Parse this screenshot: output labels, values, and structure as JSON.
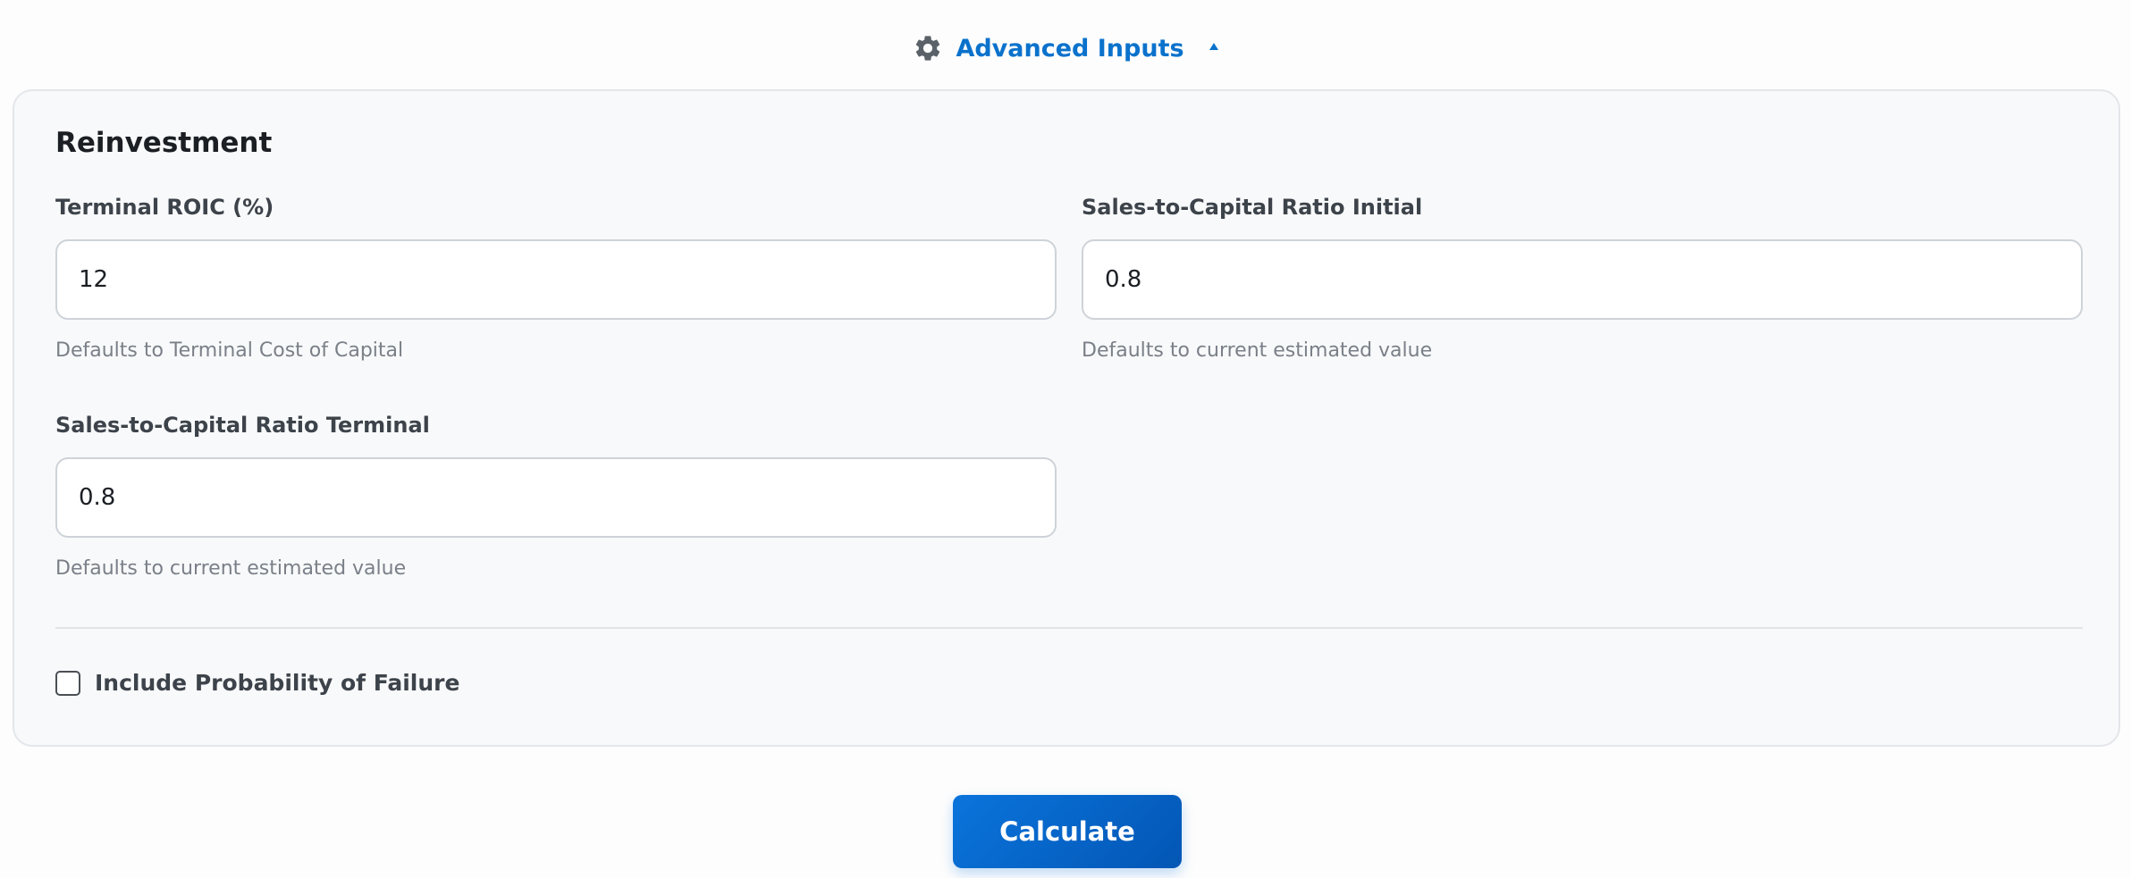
{
  "header": {
    "icon": "gear-icon",
    "title": "Advanced Inputs",
    "caret_icon": "caret-up-icon"
  },
  "section": {
    "title": "Reinvestment",
    "fields": [
      {
        "label": "Terminal ROIC (%)",
        "value": "12",
        "hint": "Defaults to Terminal Cost of Capital"
      },
      {
        "label": "Sales-to-Capital Ratio Initial",
        "value": "0.8",
        "hint": "Defaults to current estimated value"
      },
      {
        "label": "Sales-to-Capital Ratio Terminal",
        "value": "0.8",
        "hint": "Defaults to current estimated value"
      }
    ],
    "checkbox": {
      "label": "Include Probability of Failure",
      "checked": false
    }
  },
  "actions": {
    "calculate_label": "Calculate"
  },
  "colors": {
    "accent": "#0b72cc",
    "button": "#0a74dc",
    "card_bg": "#f8f9fa",
    "border": "#ced3d9"
  }
}
